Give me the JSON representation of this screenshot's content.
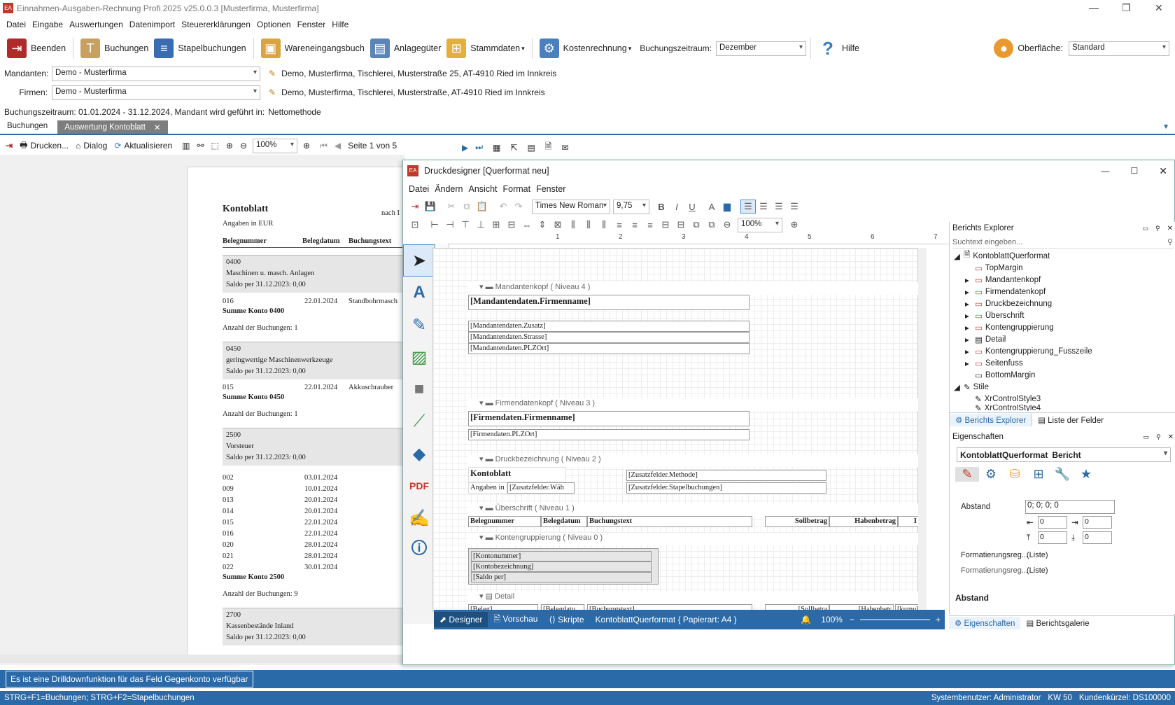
{
  "app": {
    "title": "Einnahmen-Ausgaben-Rechnung Profi 2025 v25.0.0.3 [Musterfirma, Musterfirma]"
  },
  "menu": [
    "Datei",
    "Eingabe",
    "Auswertungen",
    "Datenimport",
    "Steuererklärungen",
    "Optionen",
    "Fenster",
    "Hilfe"
  ],
  "ribbon": {
    "beenden": "Beenden",
    "buchungen": "Buchungen",
    "stapel": "Stapelbuchungen",
    "waren": "Wareneingangsbuch",
    "anlage": "Anlagegüter",
    "stamm": "Stammdaten",
    "kosten": "Kostenrechnung",
    "zeitraum_label": "Buchungszeitraum:",
    "zeitraum_value": "Dezember",
    "hilfe": "Hilfe",
    "oberflaeche_label": "Oberfläche:",
    "oberflaeche_value": "Standard"
  },
  "mandanten": {
    "label": "Mandanten:",
    "value": "Demo - Musterfirma",
    "address": "Demo, Musterfirma, Tischlerei, Musterstraße 25, AT-4910 Ried im Innkreis"
  },
  "firmen": {
    "label": "Firmen:",
    "value": "Demo - Musterfirma",
    "address": "Demo, Musterfirma, Tischlerei, Musterstraße, AT-4910 Ried im Innkreis"
  },
  "period_info": {
    "label": "Buchungszeitraum: 01.01.2024 - 31.12.2024, Mandant wird geführt in:",
    "value": "Nettomethode"
  },
  "tabs": [
    "Buchungen",
    "Auswertung Kontoblatt"
  ],
  "viewer": {
    "drucken": "Drucken...",
    "dialog": "Dialog",
    "aktualisieren": "Aktualisieren",
    "zoom": "100%",
    "page": "Seite 1 von 5"
  },
  "report": {
    "title": "Kontoblatt",
    "subtitle": "Angaben in EUR",
    "nach": "nach I",
    "cols": [
      "Belegnummer",
      "Belegdatum",
      "Buchungstext"
    ],
    "groups": [
      {
        "konto": "0400",
        "name": "Maschinen u. masch. Anlagen",
        "saldo": "Saldo per 31.12.2023: 0,00",
        "rows": [
          [
            "016",
            "22.01.2024",
            "Standbohrmasch"
          ]
        ],
        "summe": "Summe Konto 0400",
        "anzahl": "Anzahl der Buchungen: 1"
      },
      {
        "konto": "0450",
        "name": "geringwertige Maschinenwerkzeuge",
        "saldo": "Saldo per 31.12.2023: 0,00",
        "rows": [
          [
            "015",
            "22.01.2024",
            "Akkuschrauber"
          ]
        ],
        "summe": "Summe Konto 0450",
        "anzahl": "Anzahl der Buchungen: 1"
      },
      {
        "konto": "2500",
        "name": "Vorsteuer",
        "saldo": "Saldo per 31.12.2023: 0,00",
        "rows": [
          [
            "002",
            "03.01.2024",
            ""
          ],
          [
            "009",
            "10.01.2024",
            ""
          ],
          [
            "013",
            "20.01.2024",
            ""
          ],
          [
            "014",
            "20.01.2024",
            ""
          ],
          [
            "015",
            "22.01.2024",
            ""
          ],
          [
            "016",
            "22.01.2024",
            ""
          ],
          [
            "020",
            "28.01.2024",
            ""
          ],
          [
            "021",
            "28.01.2024",
            ""
          ],
          [
            "022",
            "30.01.2024",
            ""
          ]
        ],
        "summe": "Summe Konto 2500",
        "anzahl": "Anzahl der Buchungen: 9"
      },
      {
        "konto": "2700",
        "name": "Kassenbestände Inland",
        "saldo": "Saldo per 31.12.2023: 0,00",
        "rows": [],
        "summe": "",
        "anzahl": ""
      }
    ]
  },
  "designer": {
    "title": "Druckdesigner [Querformat neu]",
    "menu": [
      "Datei",
      "Ändern",
      "Ansicht",
      "Format",
      "Fenster"
    ],
    "font": "Times New Roman",
    "size": "9,75",
    "zoom": "100%",
    "bands": {
      "mandantenkopf": "Mandantenkopf ( Niveau 4 )",
      "firmendatenkopf": "Firmendatenkopf ( Niveau 3 )",
      "druckbez": "Druckbezeichnung ( Niveau 2 )",
      "ueberschrift": "Überschrift ( Niveau 1 )",
      "kontengrp": "Kontengruppierung ( Niveau 0 )",
      "detail": "Detail"
    },
    "fields": {
      "m_firma": "[Mandantendaten.Firmenname]",
      "m_zusatz": "[Mandantendaten.Zusatz]",
      "m_strasse": "[Mandantendaten.Strasse]",
      "m_plz": "[Mandantendaten.PLZOrt]",
      "f_firma": "[Firmendaten.Firmenname]",
      "f_plz": "[Firmendaten.PLZOrt]",
      "kontoblatt": "Kontoblatt",
      "angaben": "Angaben in",
      "waehr": "[Zusatzfelder.Wäh",
      "methode": "[Zusatzfelder.Methode]",
      "stapel": "[Zusatzfelder.Stapelbuchungen]",
      "h_beleg": "Belegnummer",
      "h_datum": "Belegdatum",
      "h_text": "Buchungstext",
      "h_soll": "Sollbetrag",
      "h_haben": "Habenbetrag",
      "h_k": "I",
      "k_nr": "[Kontonummer]",
      "k_bez": "[Kontobezeichnung]",
      "k_saldo": "[Saldo per]",
      "d_beleg": "[Beleg]",
      "d_datum": "[Belegdatu",
      "d_text": "[Buchungstext]",
      "d_soll": "[Sollbetra",
      "d_haben": "[Habenbetr",
      "d_kum": "[kumuli"
    },
    "explorer": {
      "title": "Berichts Explorer",
      "search": "Suchtext eingeben...",
      "root": "KontoblattQuerformat",
      "items": [
        "TopMargin",
        "Mandantenkopf",
        "Firmendatenkopf",
        "Druckbezeichnung",
        "Überschrift",
        "Kontengruppierung",
        "Detail",
        "Kontengruppierung_Fusszeile",
        "Seitenfuss",
        "BottomMargin"
      ],
      "stile": "Stile",
      "styles": [
        "XrControlStyle3",
        "XrControlStyle4"
      ],
      "tab1": "Berichts Explorer",
      "tab2": "Liste der Felder"
    },
    "props": {
      "title": "Eigenschaften",
      "object": "KontoblattQuerformat",
      "type": "Bericht",
      "abstand_label": "Abstand",
      "abstand": "0; 0; 0; 0",
      "l": "0",
      "r": "0",
      "t": "0",
      "b": "0",
      "fmt1_label": "Formatierungsreg...",
      "fmt1": "(Liste)",
      "fmt2_label": "Formatierungsreg...",
      "fmt2": "(Liste)",
      "section": "Abstand",
      "tab1": "Eigenschaften",
      "tab2": "Berichtsgalerie"
    },
    "bottom": {
      "designer": "Designer",
      "vorschau": "Vorschau",
      "skripte": "Skripte",
      "info": "KontoblattQuerformat { Papierart: A4 }",
      "zoom": "100%"
    }
  },
  "hint": "Es ist eine Drilldownfunktion für das Feld Gegenkonto verfügbar",
  "status": {
    "left": "STRG+F1=Buchungen; STRG+F2=Stapelbuchungen",
    "user": "Systembenutzer: Administrator",
    "kw": "KW 50",
    "kunde": "Kundenkürzel: DS100000"
  }
}
